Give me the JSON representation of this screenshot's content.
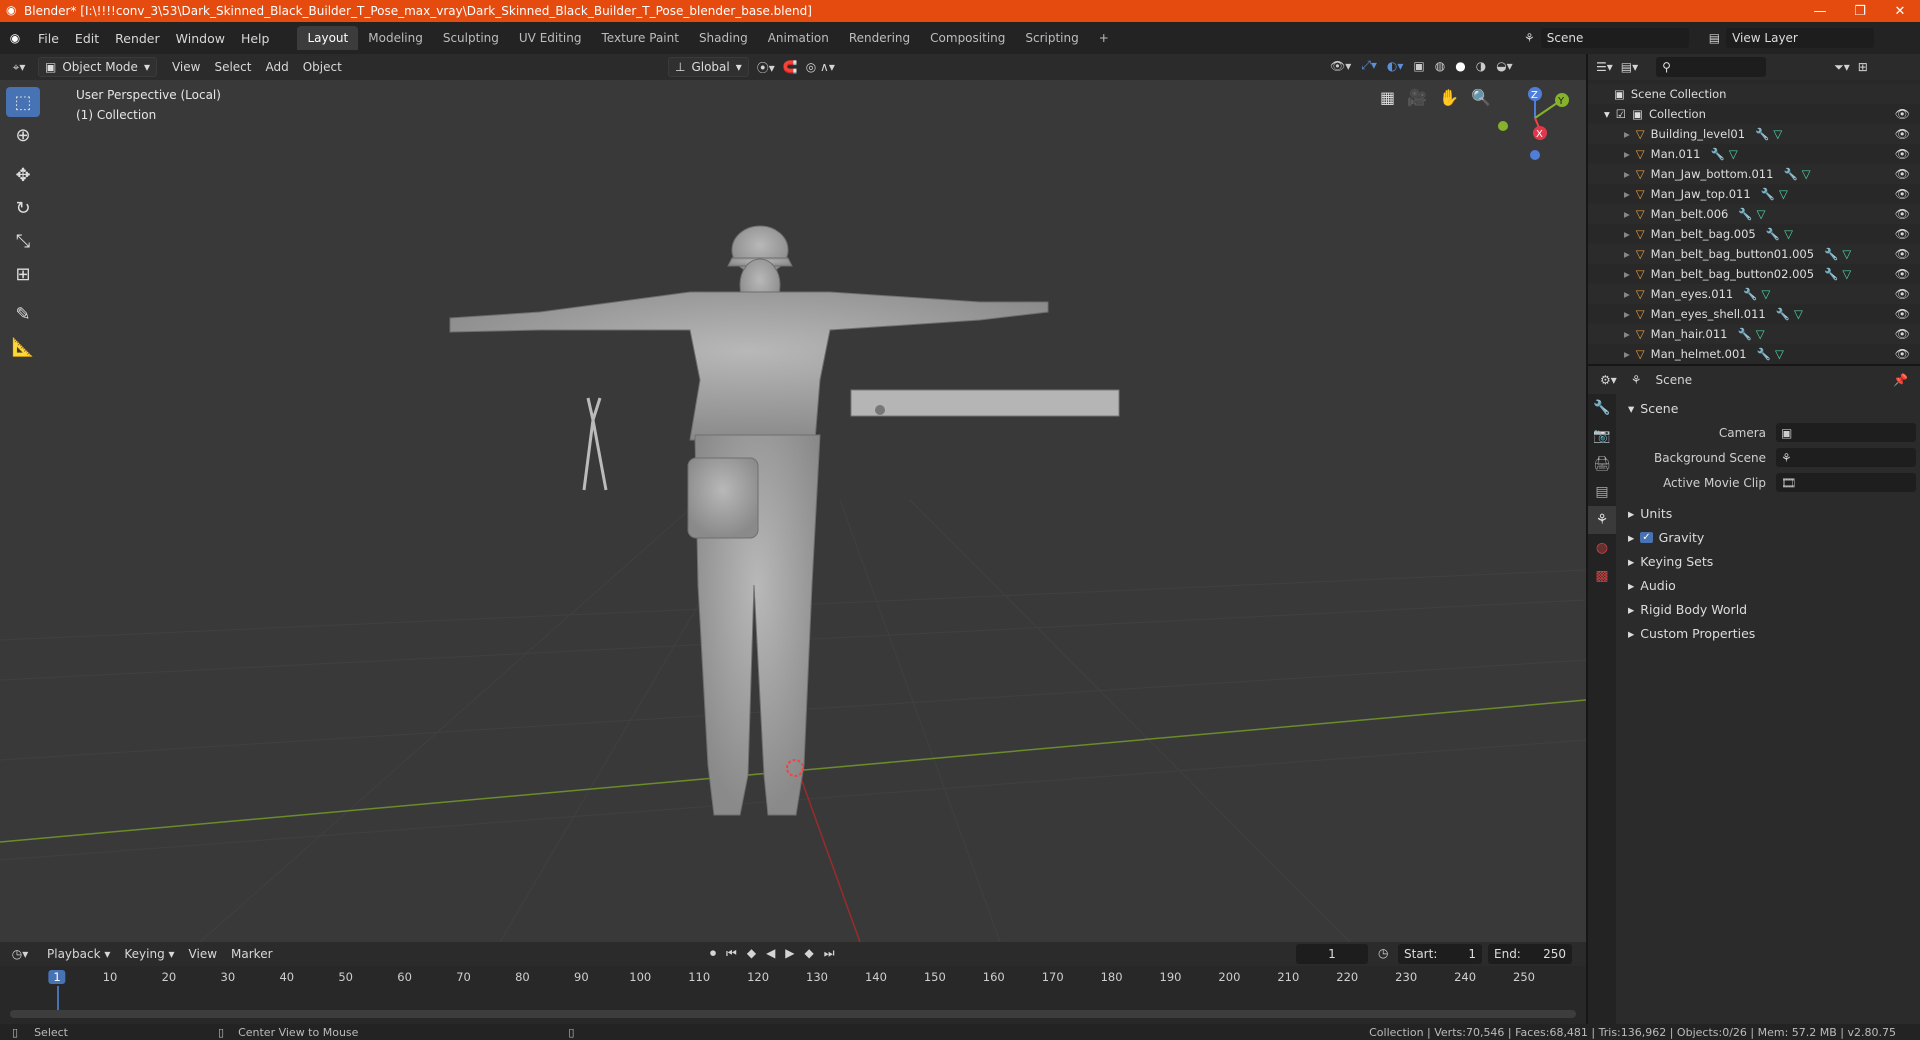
{
  "title": "Blender* [I:\\!!!!conv_3\\53\\Dark_Skinned_Black_Builder_T_Pose_max_vray\\Dark_Skinned_Black_Builder_T_Pose_blender_base.blend]",
  "menus": [
    "File",
    "Edit",
    "Render",
    "Window",
    "Help"
  ],
  "workspaces": [
    "Layout",
    "Modeling",
    "Sculpting",
    "UV Editing",
    "Texture Paint",
    "Shading",
    "Animation",
    "Rendering",
    "Compositing",
    "Scripting"
  ],
  "active_workspace": "Layout",
  "scene_field": "Scene",
  "view_layer_field": "View Layer",
  "viewport_header": {
    "mode": "Object Mode",
    "menus": [
      "View",
      "Select",
      "Add",
      "Object"
    ],
    "transform": "Global"
  },
  "viewport_info": {
    "line1": "User Perspective (Local)",
    "line2": "(1) Collection"
  },
  "axis": {
    "z": "Z",
    "y": "Y",
    "x": "X"
  },
  "outliner": {
    "root": "Scene Collection",
    "collection": "Collection",
    "items": [
      "Building_level01",
      "Man.011",
      "Man_Jaw_bottom.011",
      "Man_Jaw_top.011",
      "Man_belt.006",
      "Man_belt_bag.005",
      "Man_belt_bag_button01.005",
      "Man_belt_bag_button02.005",
      "Man_eyes.011",
      "Man_eyes_shell.011",
      "Man_hair.011",
      "Man_helmet.001"
    ]
  },
  "properties": {
    "header": "Scene",
    "section": "Scene",
    "camera_label": "Camera",
    "bg_scene_label": "Background Scene",
    "movie_clip_label": "Active Movie Clip",
    "panels": [
      "Units",
      "Gravity",
      "Keying Sets",
      "Audio",
      "Rigid Body World",
      "Custom Properties"
    ]
  },
  "timeline": {
    "menus": [
      "Playback",
      "Keying",
      "View",
      "Marker"
    ],
    "current_frame": "1",
    "start_label": "Start:",
    "start": "1",
    "end_label": "End:",
    "end": "250",
    "ticks": [
      "1",
      "10",
      "20",
      "30",
      "40",
      "50",
      "60",
      "70",
      "80",
      "90",
      "100",
      "110",
      "120",
      "130",
      "140",
      "150",
      "160",
      "170",
      "180",
      "190",
      "200",
      "210",
      "220",
      "230",
      "240",
      "250"
    ]
  },
  "status": {
    "select": "Select",
    "center": "Center View to Mouse",
    "stats": "Collection | Verts:70,546 | Faces:68,481 | Tris:136,962 | Objects:0/26 | Mem: 57.2 MB | v2.80.75"
  },
  "colors": {
    "title_bar": "#e54b0e",
    "accent": "#4772b3",
    "grid_x": "#9b2b2b",
    "grid_y": "#6a8c2a"
  }
}
